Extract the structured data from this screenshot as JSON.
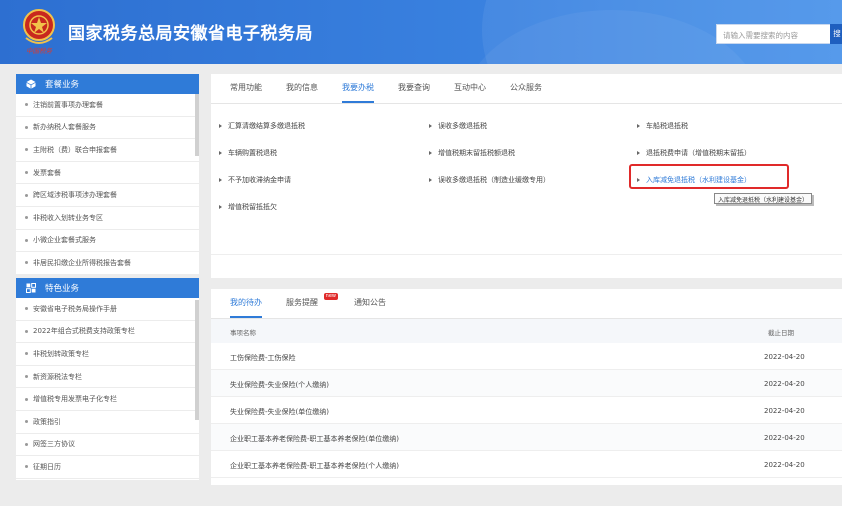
{
  "header": {
    "title": "国家税务总局安徽省电子税务局",
    "emblem_text": "中国税务",
    "search_placeholder": "请输入需要搜索的内容",
    "search_button": "搜"
  },
  "sidebar": {
    "package_section": {
      "title": "套餐业务",
      "icon": "cube-icon",
      "items": [
        "注销前置事项办理套餐",
        "新办纳税人套餐服务",
        "主附税（费）联合申报套餐",
        "发票套餐",
        "跨区域涉税事项涉办理套餐",
        "非税收入划转业务专区",
        "小微企业套餐式服务",
        "非居民扣缴企业所得税报告套餐"
      ]
    },
    "special_section": {
      "title": "特色业务",
      "icon": "grid-icon",
      "items": [
        "安徽省电子税务局操作手册",
        "2022年组合式税费支持政策专栏",
        "非税划转政策专栏",
        "新资源税法专栏",
        "增值税专用发票电子化专栏",
        "政策指引",
        "网签三方协议",
        "征期日历"
      ]
    }
  },
  "services": {
    "tabs": [
      "常用功能",
      "我的信息",
      "我要办税",
      "我要查询",
      "互动中心",
      "公众服务"
    ],
    "active_tab": "我要办税",
    "items": [
      "汇算清缴结算多缴退抵税",
      "误收多缴退抵税",
      "车船税退抵税",
      "车辆购置税退税",
      "增值税期末留抵税额退税",
      "退抵税费申请（增值税期末留抵）",
      "不予加收滞纳金申请",
      "误收多缴退抵税（制造业缓缴专用）",
      "入库减免退抵税（水利建设基金）",
      "增值税留抵抵欠"
    ],
    "tooltip": "入库减免退抵税（水利建设基金）"
  },
  "todo": {
    "tabs": [
      "我的待办",
      "服务提醒",
      "通知公告"
    ],
    "active_tab": "我的待办",
    "new_badge": "new",
    "col_name": "事项名称",
    "col_date": "截止日期",
    "rows": [
      {
        "name": "工伤保险费-工伤保险",
        "date": "2022-04-20"
      },
      {
        "name": "失业保险费-失业保险(个人缴纳)",
        "date": "2022-04-20"
      },
      {
        "name": "失业保险费-失业保险(单位缴纳)",
        "date": "2022-04-20"
      },
      {
        "name": "企业职工基本养老保险费-职工基本养老保险(单位缴纳)",
        "date": "2022-04-20"
      },
      {
        "name": "企业职工基本养老保险费-职工基本养老保险(个人缴纳)",
        "date": "2022-04-20"
      }
    ]
  },
  "colors": {
    "primary": "#2f7bd8",
    "header": "#3a82e0",
    "highlight": "#e02a2a"
  }
}
